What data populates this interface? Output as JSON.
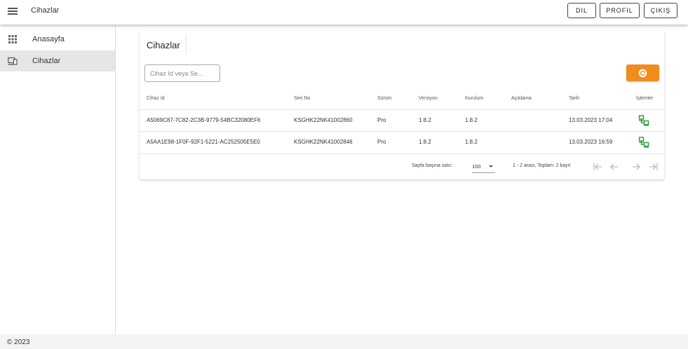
{
  "app": {
    "title": "Cihazlar"
  },
  "header": {
    "buttons": [
      "DIL",
      "PROFIL",
      "ÇIKIŞ"
    ]
  },
  "sidebar": {
    "items": [
      {
        "label": "Anasayfa",
        "icon": "apps-grid-icon",
        "active": false
      },
      {
        "label": "Cihazlar",
        "icon": "devices-icon",
        "active": true
      }
    ]
  },
  "main": {
    "title": "Cihazlar",
    "search": {
      "placeholder": "Cihaz Id veya Se...",
      "value": ""
    },
    "refresh_icon": "refresh-icon",
    "table": {
      "columns": [
        "Cihaz Id",
        "Seri No",
        "Sürüm",
        "Versiyon",
        "Kurulum",
        "Açıklama",
        "Tarih",
        "İşlemler"
      ],
      "rows": [
        [
          "A5069C87-7C82-2C3B-9779-54BC32080EF6",
          "KSGHK22NK41002860",
          "Pro",
          "1.8.2",
          "1.8.2",
          "",
          "13.03.2023 17:04"
        ],
        [
          "A5AA1E98-1F0F-92F1-5221-AC252505E5E0",
          "KSGHK22NK41002846",
          "Pro",
          "1.8.2",
          "1.8.2",
          "",
          "13.03.2023 16:59"
        ]
      ],
      "action_icon": "network-connect-icon"
    },
    "pagination": {
      "rows_per_page_label": "Sayfa başına satır:",
      "rows_per_page": "100",
      "range_text": "1 - 2 arası, Toplam: 2 kayıt"
    }
  },
  "footer": {
    "text": "© 2023"
  },
  "colors": {
    "accent": "#f28c1c",
    "action_icon": "#2e9a3c",
    "active_nav": "#e6e6e6"
  }
}
